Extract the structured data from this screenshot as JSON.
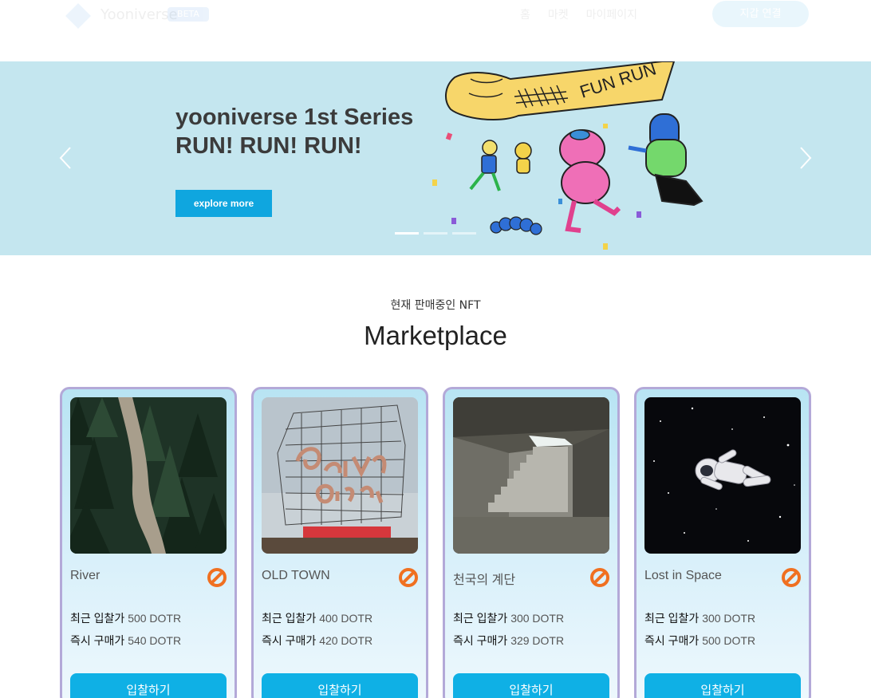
{
  "header": {
    "logo_text": "Yooniverse",
    "beta_badge": "BETA",
    "nav_items": [
      "홈",
      "마켓",
      "마이페이지"
    ],
    "connect_label": "지갑 연결"
  },
  "banner": {
    "title_line1": "yooniverse 1st Series",
    "title_line2": "RUN! RUN! RUN!",
    "button_label": "explore more",
    "art_text": "FUN RUN",
    "slide_count": 3,
    "active_slide": 0,
    "background_color": "#c4e6ef"
  },
  "section": {
    "subtitle": "현재 판매중인 NFT",
    "title": "Marketplace"
  },
  "cards": [
    {
      "name": "River",
      "bid_label": "최근 입찰가",
      "bid_value": "500 DOTR",
      "buy_label": "즉시 구매가",
      "buy_value": "540 DOTR",
      "button": "입찰하기",
      "image": "forest-river"
    },
    {
      "name": "OLD TOWN",
      "bid_label": "최근 입찰가",
      "bid_value": "400 DOTR",
      "buy_label": "즉시 구매가",
      "buy_value": "420 DOTR",
      "button": "입찰하기",
      "image": "portland-sign"
    },
    {
      "name": "천국의 계단",
      "bid_label": "최근 입찰가",
      "bid_value": "300 DOTR",
      "buy_label": "즉시 구매가",
      "buy_value": "329 DOTR",
      "button": "입찰하기",
      "image": "stairs-room"
    },
    {
      "name": "Lost in Space",
      "bid_label": "최근 입찰가",
      "bid_value": "300 DOTR",
      "buy_label": "즉시 구매가",
      "buy_value": "500 DOTR",
      "button": "입찰하기",
      "image": "astronaut-space"
    }
  ],
  "colors": {
    "accent": "#0fb0e5",
    "card_border": "#b3a9d8",
    "coin": "#f07020"
  },
  "icons": {
    "coin": "dotr-coin-icon",
    "prev": "chevron-left-icon",
    "next": "chevron-right-icon"
  }
}
